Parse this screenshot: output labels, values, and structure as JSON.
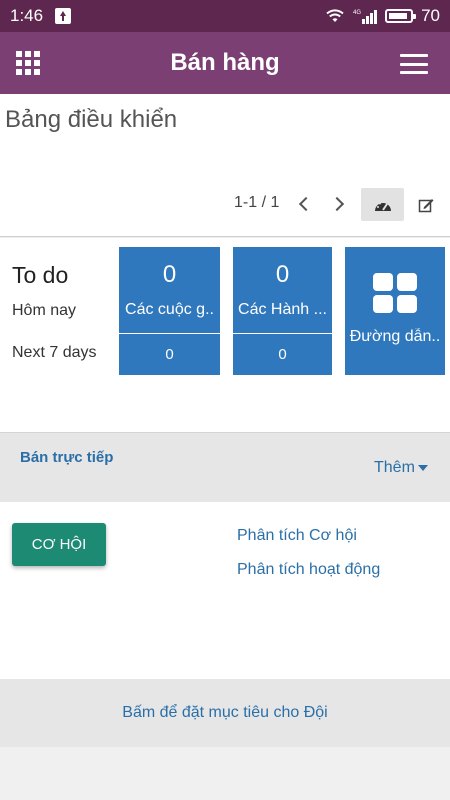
{
  "status_bar": {
    "time": "1:46",
    "battery_text": "70",
    "network_label": "4G"
  },
  "app_bar": {
    "title": "Bán hàng",
    "apps_icon": "apps-grid-icon",
    "menu_icon": "hamburger-menu-icon"
  },
  "page": {
    "breadcrumb": "Bảng điều khiển",
    "pager": "1-1 / 1"
  },
  "todo": {
    "title": "To do",
    "today_label": "Hôm nay",
    "next_label": "Next 7 days",
    "tiles": [
      {
        "count": "0",
        "label": "Các cuộc g..",
        "sub": "0"
      },
      {
        "count": "0",
        "label": "Các Hành ...",
        "sub": "0"
      },
      {
        "label": "Đường dẫn.."
      }
    ]
  },
  "team": {
    "name": "Bán trực tiếp",
    "more_label": "Thêm",
    "opportunity_button": "CƠ HỘI",
    "reports": [
      "Phân tích Cơ hội",
      "Phân tích hoạt động"
    ],
    "target_link": "Bấm để đặt mục tiêu cho Đội"
  },
  "colors": {
    "status_bar": "#5e2750",
    "app_bar": "#7b3f74",
    "tile": "#2f78bd",
    "primary_button": "#1d8a74",
    "link": "#2a6fa8"
  }
}
